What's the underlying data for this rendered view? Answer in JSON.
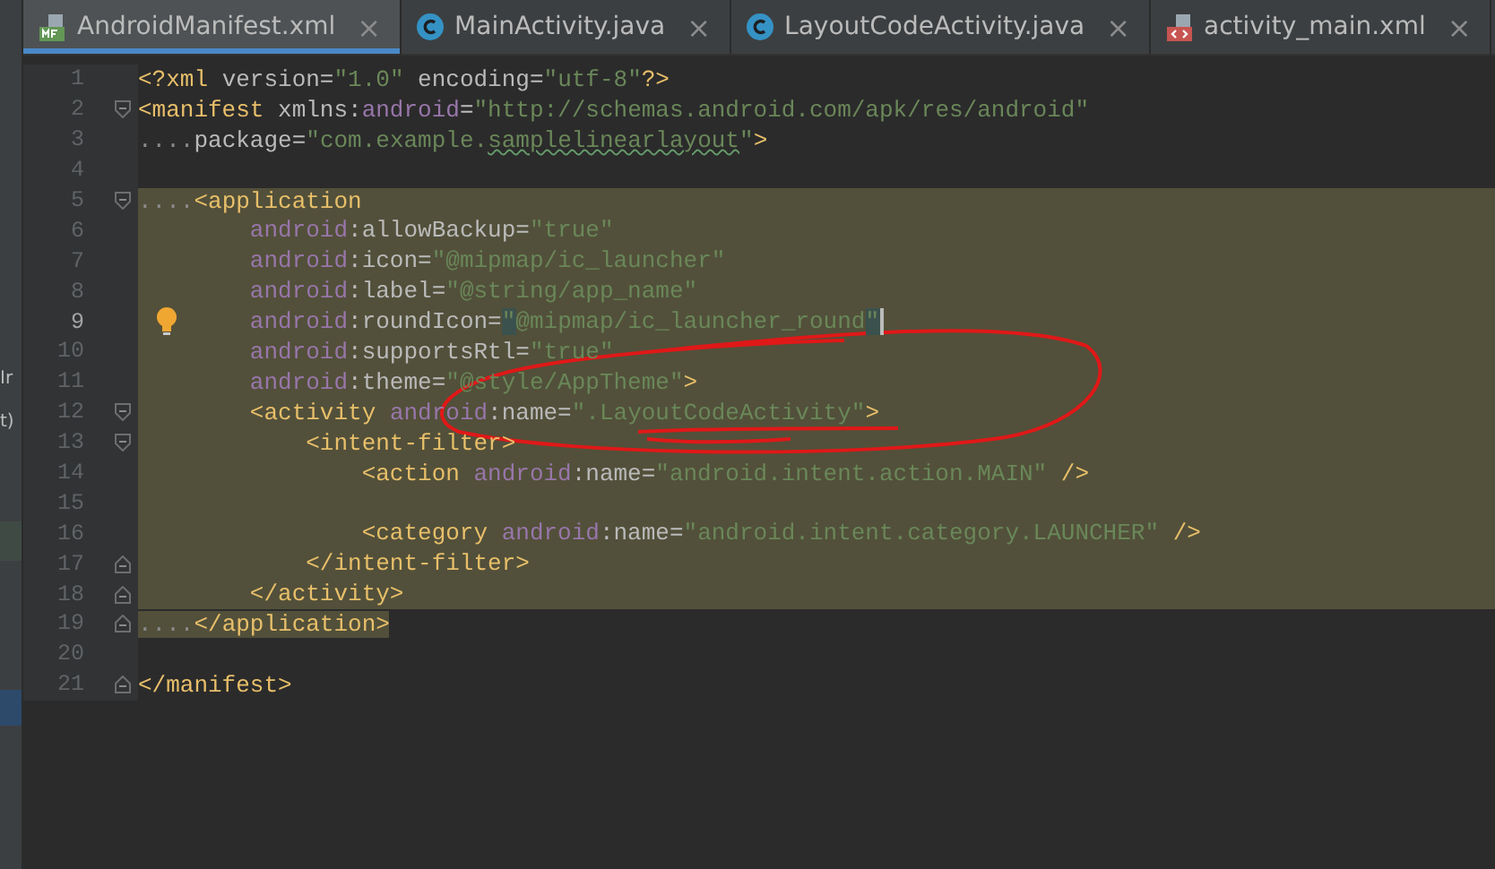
{
  "tabs": [
    {
      "label": "AndroidManifest.xml",
      "kind": "manifest",
      "selected": true,
      "close": "×"
    },
    {
      "label": "MainActivity.java",
      "kind": "java",
      "selected": false,
      "close": "×"
    },
    {
      "label": "LayoutCodeActivity.java",
      "kind": "java",
      "selected": false,
      "close": "×"
    },
    {
      "label": "activity_main.xml",
      "kind": "xml",
      "selected": false,
      "close": "×"
    }
  ],
  "side_panel": {
    "fragments": [
      "Ir",
      "t)"
    ]
  },
  "editor": {
    "lines": [
      {
        "number": "1",
        "current": false,
        "kind": "plain",
        "fold_start": false,
        "fold_end": false,
        "tokens": [
          {
            "kind": "tag",
            "text": "<?xml "
          },
          {
            "kind": "attr",
            "text": "version="
          },
          {
            "kind": "str",
            "text": "\"1.0\""
          },
          {
            "kind": "attr",
            "text": " encoding="
          },
          {
            "kind": "str",
            "text": "\"utf-8\""
          },
          {
            "kind": "tag",
            "text": "?>"
          }
        ]
      },
      {
        "number": "2",
        "current": false,
        "kind": "plain",
        "fold_start": true,
        "fold_end": false,
        "tokens": [
          {
            "kind": "tag",
            "text": "<manifest "
          },
          {
            "kind": "attr",
            "text": "xmlns:"
          },
          {
            "kind": "ns",
            "text": "android"
          },
          {
            "kind": "attr",
            "text": "="
          },
          {
            "kind": "str",
            "text": "\"http://schemas.android.com/apk/res/android\""
          }
        ]
      },
      {
        "number": "3",
        "current": false,
        "kind": "plain",
        "fold_start": false,
        "fold_end": false,
        "tokens": [
          {
            "kind": "ws",
            "text": "...."
          },
          {
            "kind": "attr",
            "text": "package="
          },
          {
            "kind": "str",
            "text": "\"com.example."
          },
          {
            "kind": "typo",
            "text": "samplelinearlayout"
          },
          {
            "kind": "str",
            "text": "\""
          },
          {
            "kind": "tag",
            "text": ">"
          }
        ]
      },
      {
        "number": "4",
        "current": false,
        "kind": "plain",
        "fold_start": false,
        "fold_end": false
      },
      {
        "number": "5",
        "current": false,
        "kind": "selection-start",
        "fold_start": true,
        "fold_end": false,
        "tokens": [
          {
            "kind": "ws",
            "text": "...."
          },
          {
            "kind": "tag",
            "text": "<application"
          }
        ]
      },
      {
        "number": "6",
        "current": false,
        "kind": "selected",
        "fold_start": false,
        "fold_end": false,
        "tokens": [
          {
            "kind": "ns",
            "text": "        android"
          },
          {
            "kind": "attr",
            "text": ":allowBackup="
          },
          {
            "kind": "str",
            "text": "\"true\""
          }
        ]
      },
      {
        "number": "7",
        "current": false,
        "kind": "selected",
        "fold_start": false,
        "fold_end": false,
        "tokens": [
          {
            "kind": "ns",
            "text": "        android"
          },
          {
            "kind": "attr",
            "text": ":icon="
          },
          {
            "kind": "str",
            "text": "\"@mipmap/ic_launcher\""
          }
        ]
      },
      {
        "number": "8",
        "current": false,
        "kind": "selected",
        "fold_start": false,
        "fold_end": false,
        "tokens": [
          {
            "kind": "ns",
            "text": "        android"
          },
          {
            "kind": "attr",
            "text": ":label="
          },
          {
            "kind": "str",
            "text": "\"@string/app_name\""
          }
        ]
      },
      {
        "number": "9",
        "current": true,
        "kind": "selected",
        "fold_start": false,
        "fold_end": false,
        "bulb": true,
        "tokens": [
          {
            "kind": "ns",
            "text": "        android"
          },
          {
            "kind": "attr",
            "text": ":roundIcon="
          },
          {
            "kind": "match",
            "text": "\""
          },
          {
            "kind": "str",
            "text": "@mipmap/ic_launcher_round"
          },
          {
            "kind": "match",
            "text": "\""
          }
        ]
      },
      {
        "number": "10",
        "current": false,
        "kind": "selected",
        "fold_start": false,
        "fold_end": false,
        "tokens": [
          {
            "kind": "ns",
            "text": "        android"
          },
          {
            "kind": "attr",
            "text": ":supportsRtl="
          },
          {
            "kind": "str",
            "text": "\"true\""
          }
        ]
      },
      {
        "number": "11",
        "current": false,
        "kind": "selected",
        "fold_start": false,
        "fold_end": false,
        "tokens": [
          {
            "kind": "ns",
            "text": "        android"
          },
          {
            "kind": "attr",
            "text": ":theme="
          },
          {
            "kind": "str",
            "text": "\"@style/AppTheme\""
          },
          {
            "kind": "tag",
            "text": ">"
          }
        ]
      },
      {
        "number": "12",
        "current": false,
        "kind": "selected",
        "fold_start": true,
        "fold_end": false,
        "tokens": [
          {
            "kind": "tag",
            "text": "        <activity "
          },
          {
            "kind": "ns",
            "text": "android"
          },
          {
            "kind": "attr",
            "text": ":name="
          },
          {
            "kind": "str",
            "text": "\".LayoutCodeActivity\""
          },
          {
            "kind": "tag",
            "text": ">"
          }
        ]
      },
      {
        "number": "13",
        "current": false,
        "kind": "selected",
        "fold_start": true,
        "fold_end": false,
        "tokens": [
          {
            "kind": "tag",
            "text": "            <intent-filter>"
          }
        ]
      },
      {
        "number": "14",
        "current": false,
        "kind": "selected",
        "fold_start": false,
        "fold_end": false,
        "tokens": [
          {
            "kind": "tag",
            "text": "                <action "
          },
          {
            "kind": "ns",
            "text": "android"
          },
          {
            "kind": "attr",
            "text": ":name="
          },
          {
            "kind": "str",
            "text": "\"android.intent.action.MAIN\""
          },
          {
            "kind": "tag",
            "text": " />"
          }
        ]
      },
      {
        "number": "15",
        "current": false,
        "kind": "selected",
        "fold_start": false,
        "fold_end": false
      },
      {
        "number": "16",
        "current": false,
        "kind": "selected",
        "fold_start": false,
        "fold_end": false,
        "tokens": [
          {
            "kind": "tag",
            "text": "                <category "
          },
          {
            "kind": "ns",
            "text": "android"
          },
          {
            "kind": "attr",
            "text": ":name="
          },
          {
            "kind": "str",
            "text": "\"android.intent.category.LAUNCHER\""
          },
          {
            "kind": "tag",
            "text": " />"
          }
        ]
      },
      {
        "number": "17",
        "current": false,
        "kind": "selected",
        "fold_start": false,
        "fold_end": true,
        "tokens": [
          {
            "kind": "tag",
            "text": "            </intent-filter>"
          }
        ]
      },
      {
        "number": "18",
        "current": false,
        "kind": "selected",
        "fold_start": false,
        "fold_end": true,
        "tokens": [
          {
            "kind": "tag",
            "text": "        </activity>"
          }
        ]
      },
      {
        "number": "19",
        "current": false,
        "kind": "selection-end",
        "fold_start": false,
        "fold_end": true,
        "tokens": [
          {
            "kind": "ws",
            "text": "...."
          },
          {
            "kind": "tag",
            "text": "</application>"
          }
        ]
      },
      {
        "number": "20",
        "current": false,
        "kind": "plain",
        "fold_start": false,
        "fold_end": false
      },
      {
        "number": "21",
        "current": false,
        "kind": "plain",
        "fold_start": false,
        "fold_end": true,
        "tokens": [
          {
            "kind": "tag",
            "text": "</manifest>"
          }
        ]
      }
    ]
  }
}
